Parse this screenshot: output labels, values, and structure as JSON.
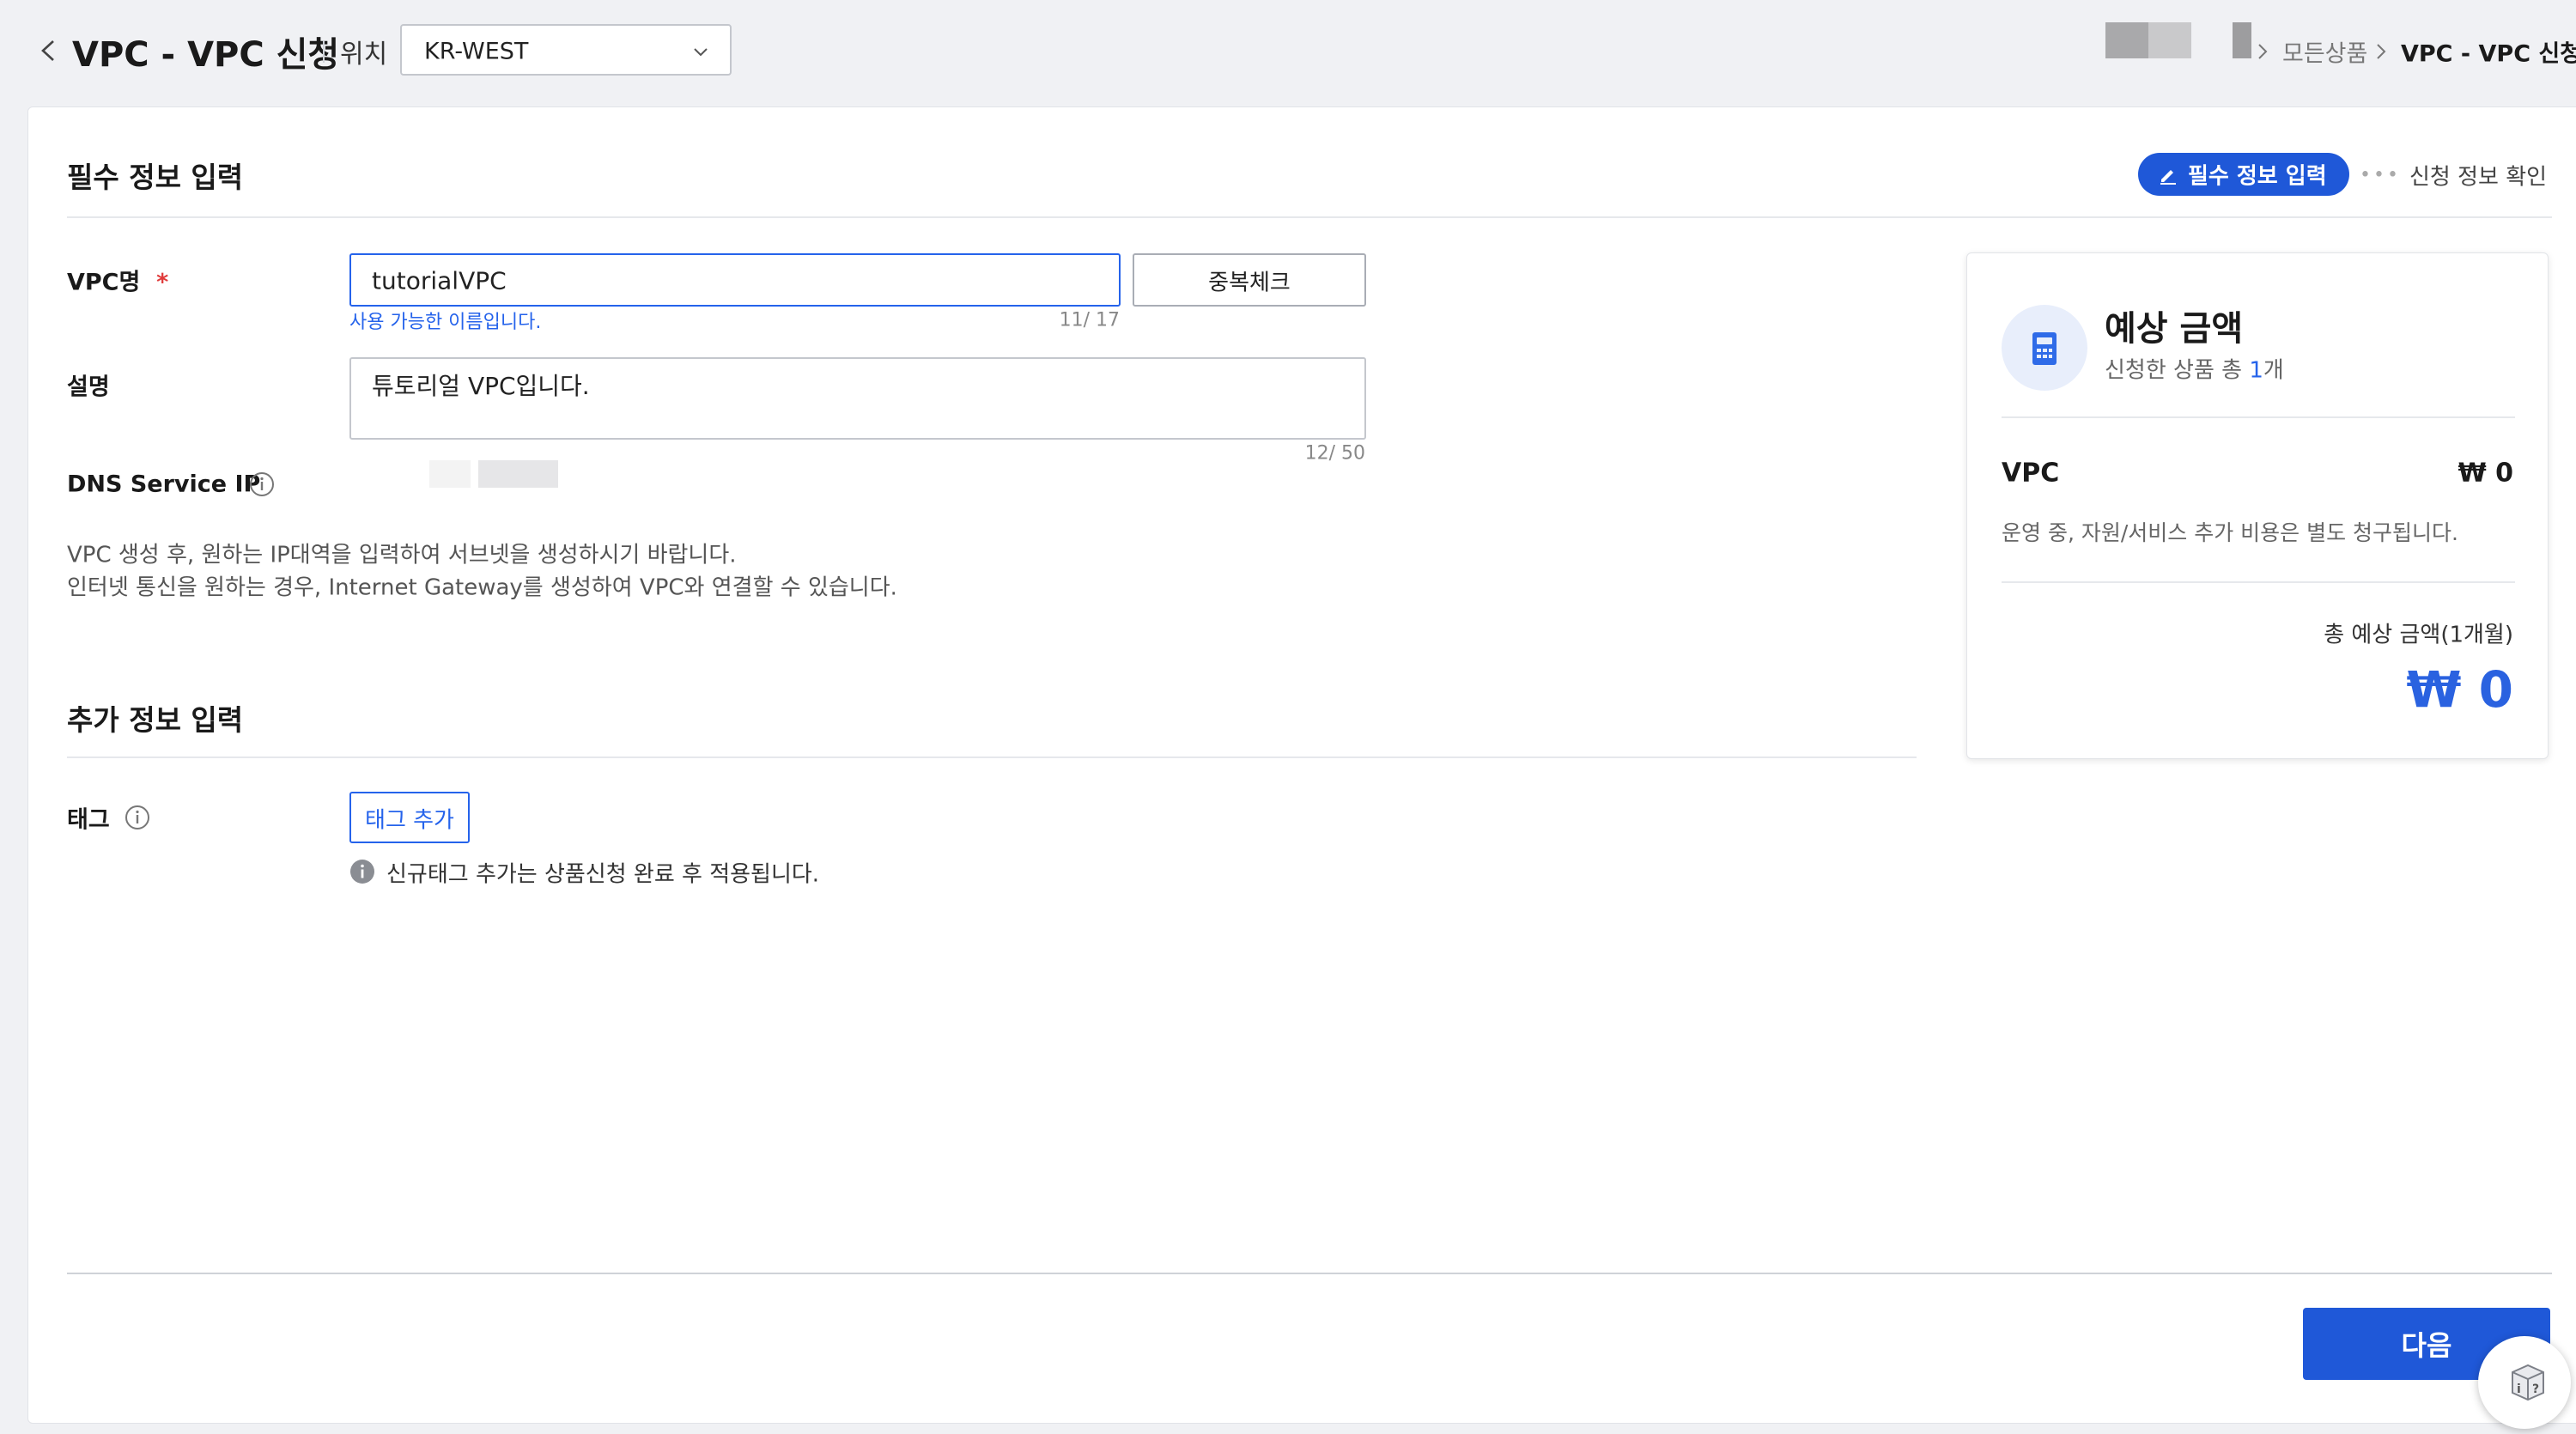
{
  "header": {
    "title": "VPC - VPC 신청",
    "location_label": "위치",
    "region": "KR-WEST",
    "breadcrumb": {
      "all_products": "모든상품",
      "current": "VPC - VPC 신청"
    }
  },
  "steps": {
    "active": "필수 정보 입력",
    "next": "신청 정보 확인"
  },
  "required_section": {
    "title": "필수 정보 입력",
    "vpc_name": {
      "label": "VPC명",
      "required_mark": "*",
      "value": "tutorialVPC",
      "check_button": "중복체크",
      "available_msg": "사용 가능한 이름입니다.",
      "counter": "11/ 17"
    },
    "description": {
      "label": "설명",
      "value": "튜토리얼 VPC입니다.",
      "counter": "12/ 50"
    },
    "dns": {
      "label": "DNS Service IP"
    },
    "guide_lines": [
      "VPC 생성 후, 원하는 IP대역을 입력하여 서브넷을 생성하시기 바랍니다.",
      "인터넷 통신을 원하는 경우, Internet Gateway를 생성하여 VPC와 연결할 수 있습니다."
    ]
  },
  "additional_section": {
    "title": "추가 정보 입력",
    "tag_label": "태그",
    "add_tag_button": "태그 추가",
    "tag_note": "신규태그 추가는 상품신청 완료 후 적용됩니다."
  },
  "price_card": {
    "title": "예상 금액",
    "subtitle_prefix": "신청한 상품 총 ",
    "product_count": "1",
    "subtitle_suffix": "개",
    "item_name": "VPC",
    "item_price": "₩ 0",
    "notice": "운영 중, 자원/서비스 추가 비용은 별도 청구됩니다.",
    "total_label": "총 예상 금액(1개월)",
    "total_value": "₩ 0"
  },
  "footer": {
    "next_button": "다음"
  },
  "colors": {
    "primary": "#1f58d8",
    "link": "#2563eb",
    "required": "#e03a3a"
  },
  "icons": [
    "back-arrow-icon",
    "chevron-down-icon",
    "chevron-right-icon",
    "pencil-icon",
    "info-icon",
    "calculator-icon",
    "help-icon"
  ]
}
